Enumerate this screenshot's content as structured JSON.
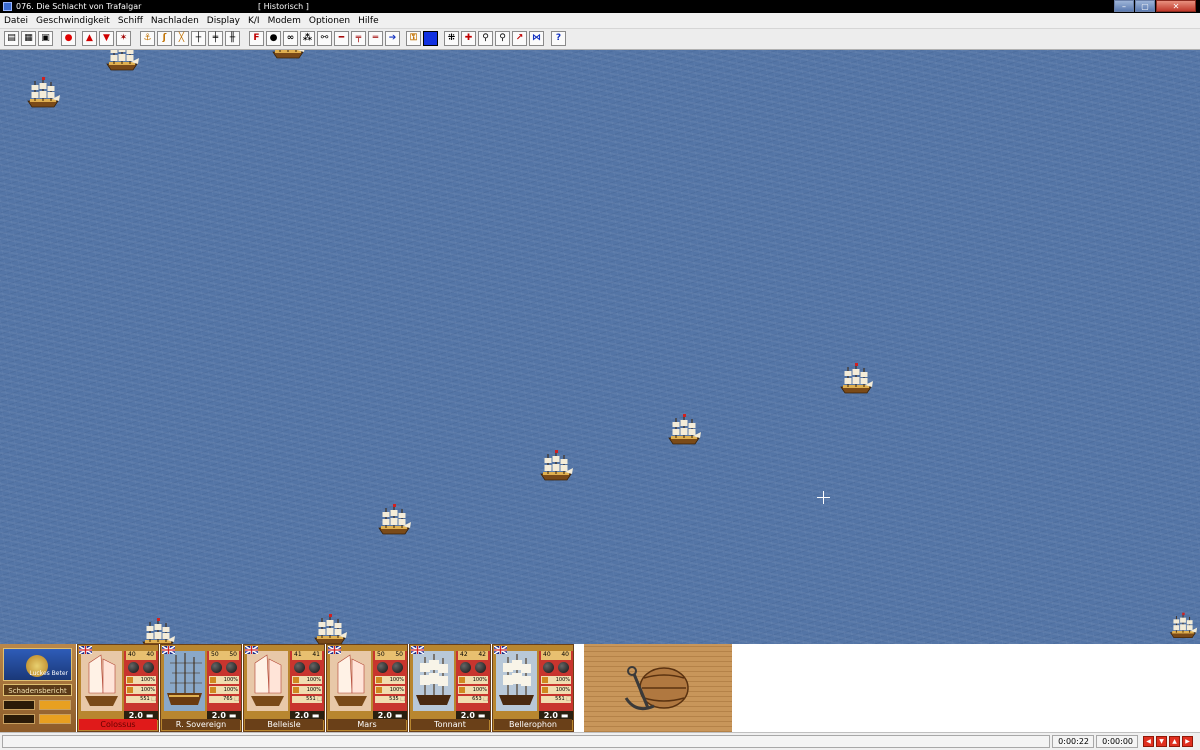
{
  "window": {
    "title": "076. Die Schlacht von Trafalgar",
    "mode": "[ Historisch ]",
    "controls": [
      "–",
      "▢",
      "✕"
    ]
  },
  "menu": [
    "Datei",
    "Geschwindigkeit",
    "Schiff",
    "Nachladen",
    "Display",
    "K/I",
    "Modem",
    "Optionen",
    "Hilfe"
  ],
  "toolbar": {
    "fire_label": "F",
    "help_label": "?"
  },
  "left_panel": {
    "logo_text": "Luckes Beter",
    "damage_report_label": "Schadensbericht"
  },
  "ships": [
    {
      "name": "Colossus",
      "guns_left": "40",
      "guns_right": "40",
      "hull": "100%",
      "rigging": "100%",
      "crew": "551 ⬚",
      "speed": "2.0",
      "selected": true
    },
    {
      "name": "R. Sovereign",
      "guns_left": "50",
      "guns_right": "50",
      "hull": "100%",
      "rigging": "100%",
      "crew": "765 ⬚",
      "speed": "2.0",
      "selected": false
    },
    {
      "name": "Belleisle",
      "guns_left": "41",
      "guns_right": "41",
      "hull": "100%",
      "rigging": "100%",
      "crew": "551 ⬚",
      "speed": "2.0",
      "selected": false
    },
    {
      "name": "Mars",
      "guns_left": "50",
      "guns_right": "50",
      "hull": "100%",
      "rigging": "100%",
      "crew": "535 ⬚",
      "speed": "2.0",
      "selected": false
    },
    {
      "name": "Tonnant",
      "guns_left": "42",
      "guns_right": "42",
      "hull": "100%",
      "rigging": "100%",
      "crew": "653 ⬚",
      "speed": "2.0",
      "selected": false
    },
    {
      "name": "Bellerophon",
      "guns_left": "40",
      "guns_right": "40",
      "hull": "100%",
      "rigging": "100%",
      "crew": "551 ⬚",
      "speed": "2.0",
      "selected": false
    }
  ],
  "status": {
    "time_elapsed": "0:00:22",
    "time_other": "0:00:00"
  },
  "colors": {
    "sea": "#5475a6",
    "panel_wood": "#b8862f",
    "stat_red": "#c8352e",
    "selected_name": "#e01a1a"
  }
}
